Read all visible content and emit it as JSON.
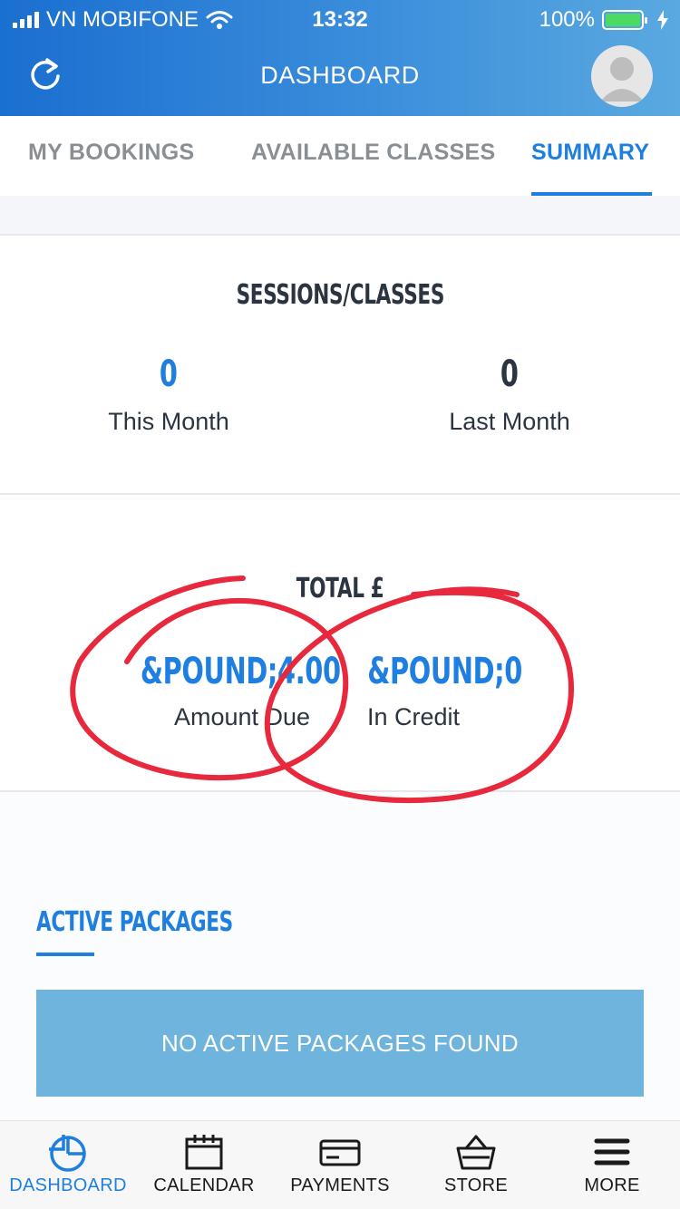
{
  "status_bar": {
    "carrier": "VN MOBIFONE",
    "time": "13:32",
    "battery": "100%",
    "battery_level": 1.0
  },
  "header": {
    "title": "DASHBOARD"
  },
  "tabs": [
    {
      "label": "MY BOOKINGS"
    },
    {
      "label": "AVAILABLE CLASSES"
    },
    {
      "label": "SUMMARY",
      "active": true
    }
  ],
  "sessions": {
    "title": "SESSIONS/CLASSES",
    "this_month": {
      "value": "0",
      "label": "This Month"
    },
    "last_month": {
      "value": "0",
      "label": "Last Month"
    }
  },
  "total": {
    "title": "TOTAL £",
    "amount_due": {
      "value": "&POUND;4.00",
      "label": "Amount Due"
    },
    "in_credit": {
      "value": "&POUND;0",
      "label": "In Credit"
    }
  },
  "active_packages": {
    "title": "ACTIVE PACKAGES",
    "empty_message": "NO ACTIVE PACKAGES FOUND"
  },
  "bottom_nav": [
    {
      "label": "DASHBOARD",
      "icon": "pie-chart-icon",
      "active": true
    },
    {
      "label": "CALENDAR",
      "icon": "calendar-icon"
    },
    {
      "label": "PAYMENTS",
      "icon": "credit-card-icon"
    },
    {
      "label": "STORE",
      "icon": "basket-icon"
    },
    {
      "label": "MORE",
      "icon": "hamburger-menu-icon"
    }
  ],
  "colors": {
    "accent": "#1e7fe0",
    "header_start": "#1a6fd0",
    "header_end": "#5aa9e0",
    "annotation": "#e8283c",
    "banner": "#6eb4dc"
  }
}
